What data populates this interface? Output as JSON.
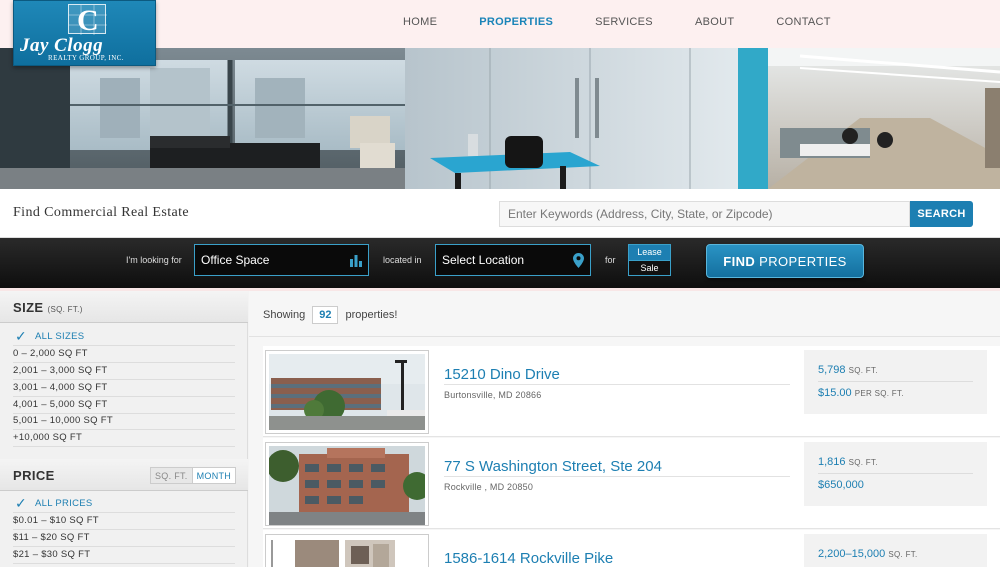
{
  "logo": {
    "mark": "C",
    "name": "Jay Clogg",
    "sub": "REALTY GROUP, INC."
  },
  "nav": [
    {
      "label": "HOME",
      "active": false
    },
    {
      "label": "PROPERTIES",
      "active": true
    },
    {
      "label": "SERVICES",
      "active": false
    },
    {
      "label": "ABOUT",
      "active": false
    },
    {
      "label": "CONTACT",
      "active": false
    }
  ],
  "find": {
    "title": "Find Commercial Real Estate",
    "placeholder": "Enter Keywords (Address, City, State, or Zipcode)",
    "search_label": "SEARCH"
  },
  "filters": {
    "looking_for_label": "I'm looking for",
    "type_value": "Office Space",
    "located_in_label": "located in",
    "location_value": "Select Location",
    "for_label": "for",
    "lease_label": "Lease",
    "sale_label": "Sale",
    "find_bold": "FIND",
    "find_rest": " PROPERTIES"
  },
  "sidebar": {
    "size": {
      "title": "SIZE",
      "unit": "(SQ. FT.)",
      "options": [
        {
          "label": "ALL SIZES",
          "selected": true
        },
        {
          "label": "0 – 2,000 SQ FT"
        },
        {
          "label": "2,001 – 3,000 SQ FT"
        },
        {
          "label": "3,001 – 4,000 SQ FT"
        },
        {
          "label": "4,001 – 5,000 SQ FT"
        },
        {
          "label": "5,001 – 10,000 SQ FT"
        },
        {
          "label": "+10,000 SQ FT"
        }
      ]
    },
    "price": {
      "title": "PRICE",
      "unit_sqft": "SQ. FT.",
      "unit_month": "MONTH",
      "options": [
        {
          "label": "ALL PRICES",
          "selected": true
        },
        {
          "label": "$0.01 – $10 SQ FT"
        },
        {
          "label": "$11 – $20 SQ FT"
        },
        {
          "label": "$21 – $30 SQ FT"
        }
      ]
    }
  },
  "results": {
    "showing_label": "Showing",
    "count": "92",
    "suffix": "properties!",
    "listings": [
      {
        "address": "15210 Dino Drive",
        "city": "Burtonsville, MD 20866",
        "sqft": "5,798",
        "sqft_unit": "SQ. FT.",
        "price": "$15.00",
        "price_unit": "PER SQ. FT."
      },
      {
        "address": "77 S Washington Street, Ste 204",
        "city": "Rockville , MD 20850",
        "sqft": "1,816",
        "sqft_unit": "SQ. FT.",
        "price": "$650,000",
        "price_unit": ""
      },
      {
        "address": "1586-1614 Rockville Pike",
        "city": "",
        "sqft": "2,200–15,000",
        "sqft_unit": "SQ. FT.",
        "price": "",
        "price_unit": ""
      }
    ]
  },
  "colors": {
    "accent": "#1d7fb2",
    "header_bg": "#fdf0f0",
    "filter_bg": "#111111"
  }
}
